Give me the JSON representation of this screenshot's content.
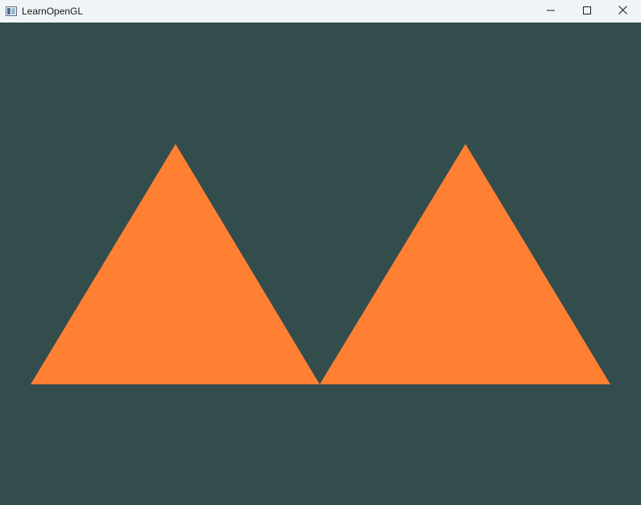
{
  "window": {
    "title": "LearnOpenGL",
    "icons": {
      "app": "opengl-window-icon",
      "minimize": "minimize-icon",
      "maximize": "maximize-icon",
      "close": "close-icon"
    }
  },
  "render": {
    "clear_color": "#334d4d",
    "triangle_color": "#ff7f33",
    "triangle_count": 2
  },
  "colors": {
    "titlebar_bg": "#eff4f9",
    "title_text": "#1a1a1a"
  }
}
